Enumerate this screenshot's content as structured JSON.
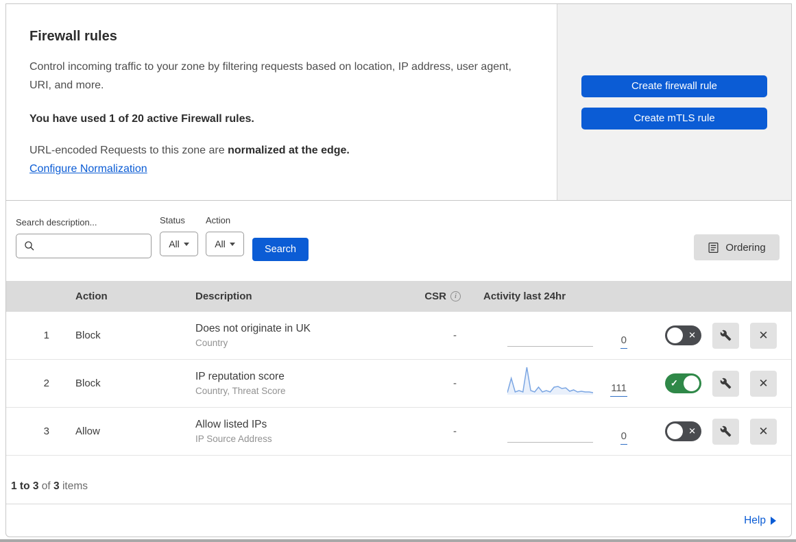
{
  "accent_blue": "#0b5cd5",
  "toggle_on_green": "#2f8848",
  "toggle_off_gray": "#494b4f",
  "header_card": {
    "title": "Firewall rules",
    "description": "Control incoming traffic to your zone by filtering requests based on location, IP address, user agent, URI, and more.",
    "usage_bold": "You have used 1 of 20 active Firewall rules.",
    "normalization_prefix": "URL-encoded Requests to this zone are ",
    "normalization_bold": "normalized at the edge.",
    "normalization_link": "Configure Normalization",
    "buttons": [
      {
        "label": "Create firewall rule"
      },
      {
        "label": "Create mTLS rule"
      }
    ]
  },
  "filters": {
    "search_label": "Search description...",
    "search_value": "",
    "status_label": "Status",
    "status_value": "All",
    "action_label": "Action",
    "action_value": "All",
    "search_button": "Search",
    "ordering_button": "Ordering"
  },
  "table": {
    "headers": {
      "action": "Action",
      "description": "Description",
      "csr": "CSR",
      "activity": "Activity last 24hr"
    },
    "rows": [
      {
        "num": "1",
        "action": "Block",
        "description": "Does not originate in UK",
        "fields": "Country",
        "csr": "-",
        "activity_count": "0",
        "enabled": false,
        "has_sparkline": false
      },
      {
        "num": "2",
        "action": "Block",
        "description": "IP reputation score",
        "fields": "Country, Threat Score",
        "csr": "-",
        "activity_count": "111",
        "enabled": true,
        "has_sparkline": true
      },
      {
        "num": "3",
        "action": "Allow",
        "description": "Allow listed IPs",
        "fields": "IP Source Address",
        "csr": "-",
        "activity_count": "0",
        "enabled": false,
        "has_sparkline": false
      }
    ]
  },
  "sparkline": {
    "color": "#7ba6e3",
    "fill": "#e9f0fb",
    "points": [
      3,
      24,
      4,
      6,
      4,
      40,
      6,
      4,
      11,
      4,
      6,
      4,
      11,
      12,
      9,
      10,
      5,
      7,
      4,
      5,
      4,
      4,
      3
    ]
  },
  "footer": {
    "range_bold": "1 to 3 ",
    "of_text": "of ",
    "total_bold": "3 ",
    "items_text": "items"
  },
  "help": {
    "label": "Help"
  }
}
